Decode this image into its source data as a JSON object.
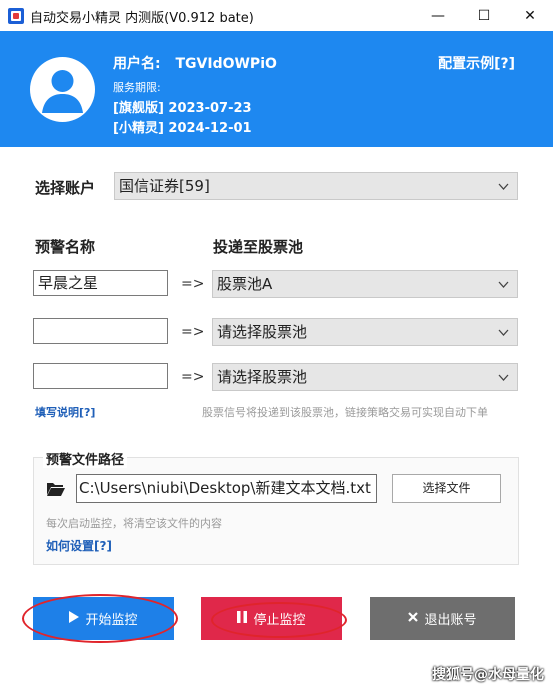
{
  "window": {
    "title": "自动交易小精灵 内测版(V0.912 bate)",
    "minimize_glyph": "—",
    "maximize_glyph": "☐",
    "close_glyph": "✕"
  },
  "header": {
    "username_prefix": "用户名:",
    "username": "TGVIdOWPiO",
    "service_label": "服务期限:",
    "flagship_label": "[旗舰版] 2023-07-23",
    "sprite_label": "[小精灵] 2024-12-01",
    "config_link": "配置示例[?]"
  },
  "account": {
    "label": "选择账户",
    "selected": "国信证券[59]"
  },
  "alerts": {
    "name_header": "预警名称",
    "pool_header": "投递至股票池",
    "arrow": "=>",
    "rows": [
      {
        "name": "早晨之星",
        "pool": "股票池A"
      },
      {
        "name": "",
        "pool": "请选择股票池"
      },
      {
        "name": "",
        "pool": "请选择股票池"
      }
    ],
    "help_link": "填写说明[?]",
    "hint": "股票信号将投递到该股票池，链接策略交易可实现自动下单"
  },
  "file": {
    "group_title": "预警文件路径",
    "path": "C:\\Users\\niubi\\Desktop\\新建文本文档.txt",
    "choose_button": "选择文件",
    "note": "每次启动监控，将清空该文件的内容",
    "howto_link": "如何设置[?]"
  },
  "buttons": {
    "start": "开始监控",
    "stop": "停止监控",
    "logout": "退出账号"
  },
  "watermark": "搜狐号@水母量化",
  "colors": {
    "header_bg": "#1e88f0",
    "start_bg": "#1e80e8",
    "stop_bg": "#e0284a",
    "logout_bg": "#6e6e6e",
    "highlight_ring": "#e0242b"
  },
  "icons": {
    "folder": "folder-icon",
    "play": "play-icon",
    "pause": "pause-icon",
    "close": "x-icon",
    "avatar": "user-avatar-icon",
    "chevron": "chevron-down-icon"
  }
}
